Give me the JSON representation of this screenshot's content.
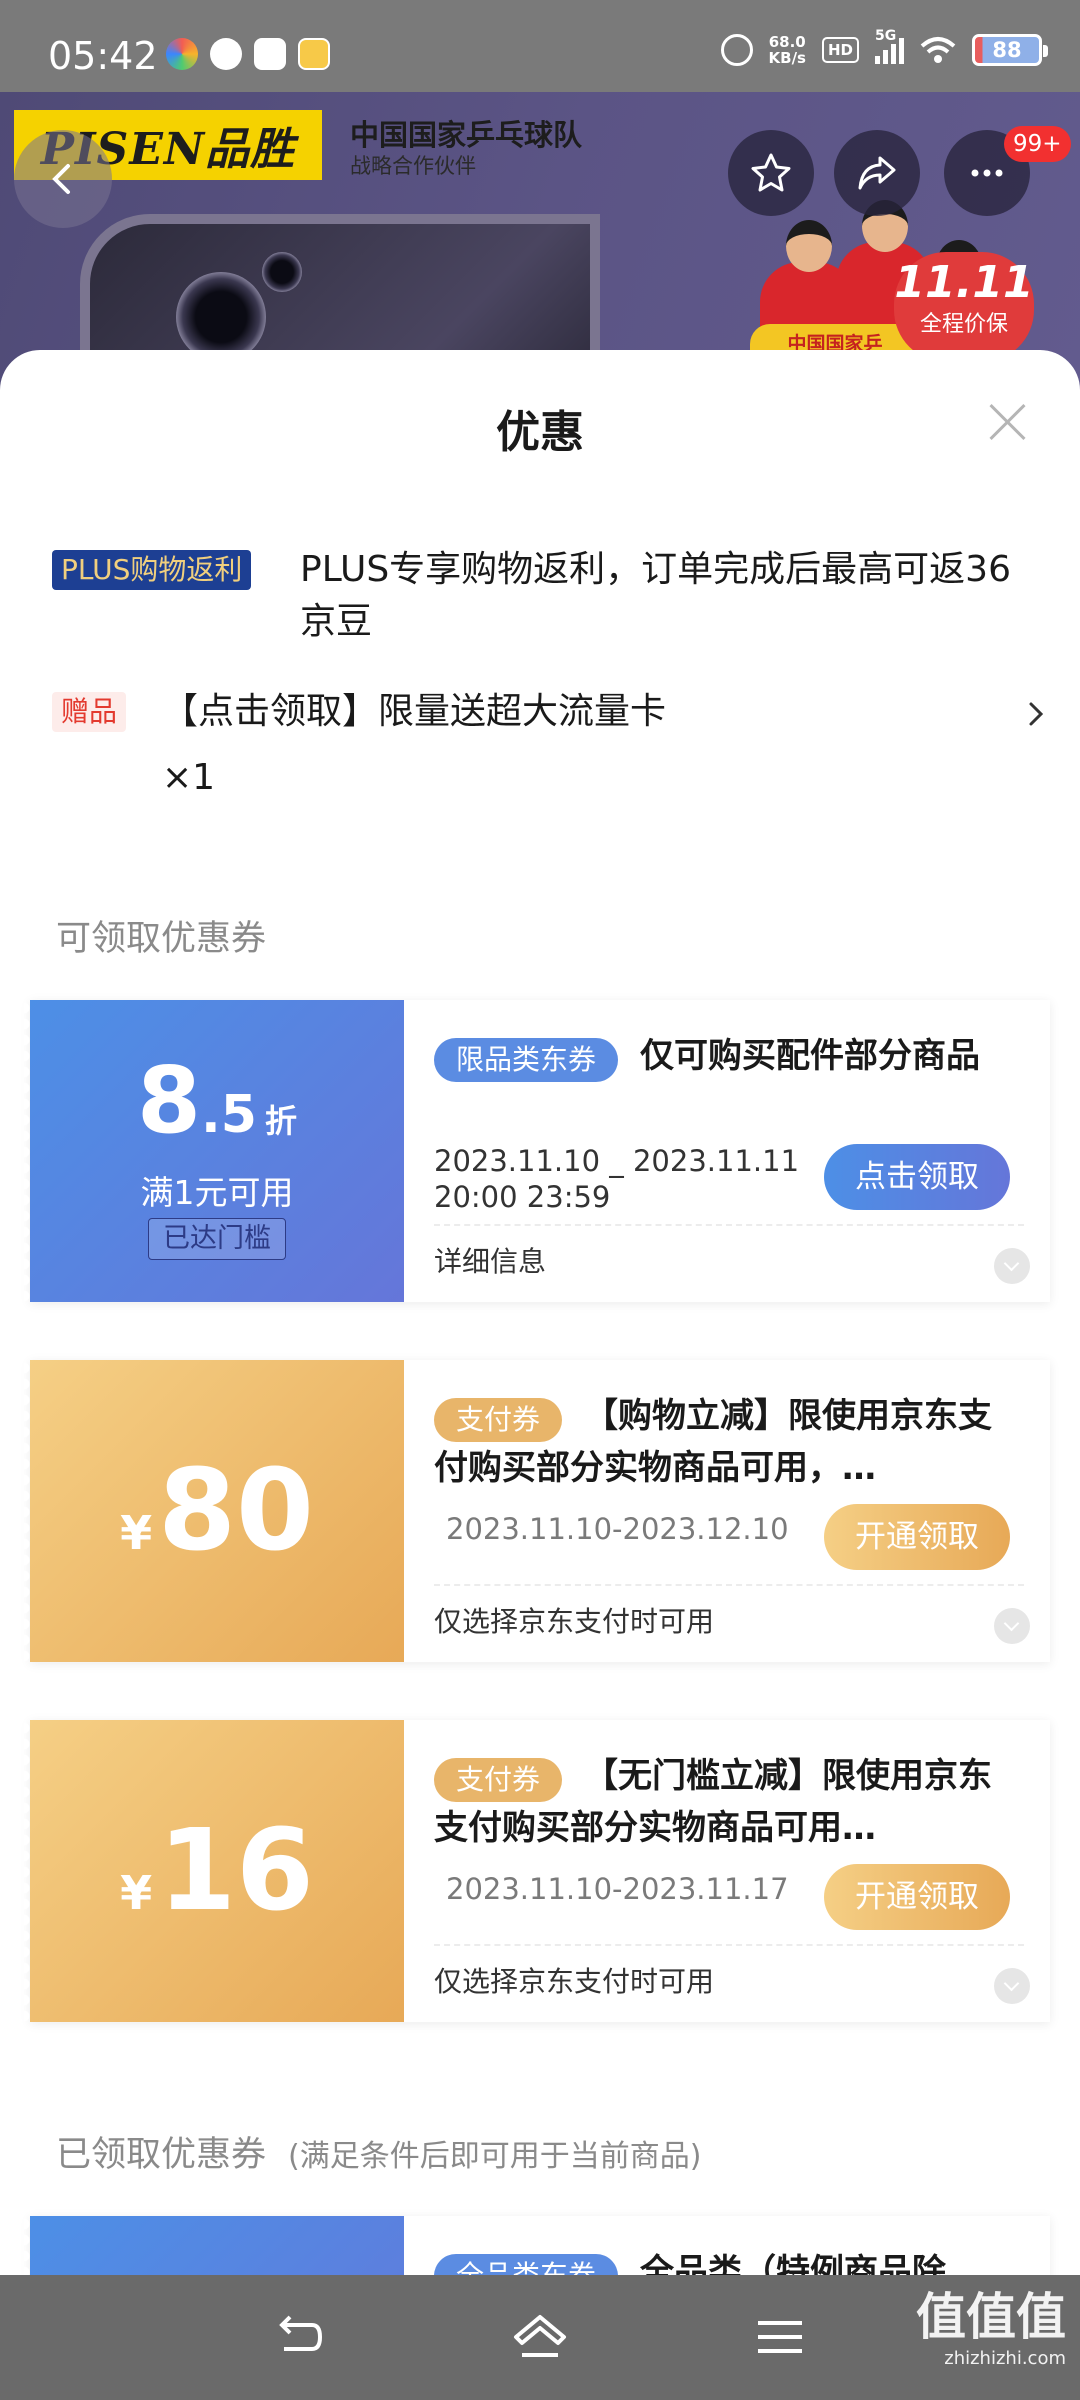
{
  "status_bar": {
    "time": "05:42",
    "net_speed_value": "68.0",
    "net_speed_unit": "KB/s",
    "hd_label": "HD",
    "network": "5G",
    "battery": "88",
    "notification_icons": [
      "photos-icon",
      "message-icon",
      "mail-icon",
      "app-icon"
    ]
  },
  "banner": {
    "brand": "PISEN品胜",
    "partner_title": "中国国家乒乓球队",
    "partner_sub": "战略合作伙伴",
    "team_strip": "中国国家乒",
    "promo_big": "11.11",
    "promo_small": "全程价保",
    "cart_badge": "99+"
  },
  "sheet": {
    "title": "优惠",
    "plus_tag": "PLUS购物返利",
    "plus_text": "PLUS专享购物返利，订单完成后最高可返36京豆",
    "gift_tag": "赠品",
    "gift_text": "【点击领取】限量送超大流量卡",
    "gift_qty": "×1",
    "available_title": "可领取优惠券",
    "claimed_title": "已领取优惠券",
    "claimed_note": "(满足条件后即可用于当前商品)"
  },
  "coupons": [
    {
      "disc_int": "8",
      "disc_dec": ".5",
      "disc_unit": "折",
      "condition": "满1元可用",
      "reached": "已达门槛",
      "tag": "限品类东券",
      "title": "仅可购买配件部分商品",
      "date_line1": "2023.11.10 _ 2023.11.11",
      "date_line2": "20:00 23:59",
      "button": "点击领取",
      "footer": "详细信息"
    },
    {
      "currency": "¥",
      "amount": "80",
      "tag": "支付券",
      "title": "【购物立减】限使用京东支付购买部分实物商品可用，…",
      "date": "2023.11.10-2023.12.10",
      "button": "开通领取",
      "footer": "仅选择京东支付时可用"
    },
    {
      "currency": "¥",
      "amount": "16",
      "tag": "支付券",
      "title": "【无门槛立减】限使用京东支付购买部分实物商品可用…",
      "date": "2023.11.10-2023.11.17",
      "button": "开通领取",
      "footer": "仅选择京东支付时可用"
    },
    {
      "tag": "全品类东券",
      "title": "全品类（特例商品除"
    }
  ],
  "nav": {
    "watermark": "值值值",
    "watermark_sub": "zhizhizhi.com"
  },
  "colors": {
    "blue_start": "#4d8fe6",
    "blue_end": "#6576d9",
    "gold_start": "#f5cf85",
    "gold_end": "#e7a957",
    "gift_red": "#e33a2f",
    "plus_navy": "#1d3f93"
  }
}
